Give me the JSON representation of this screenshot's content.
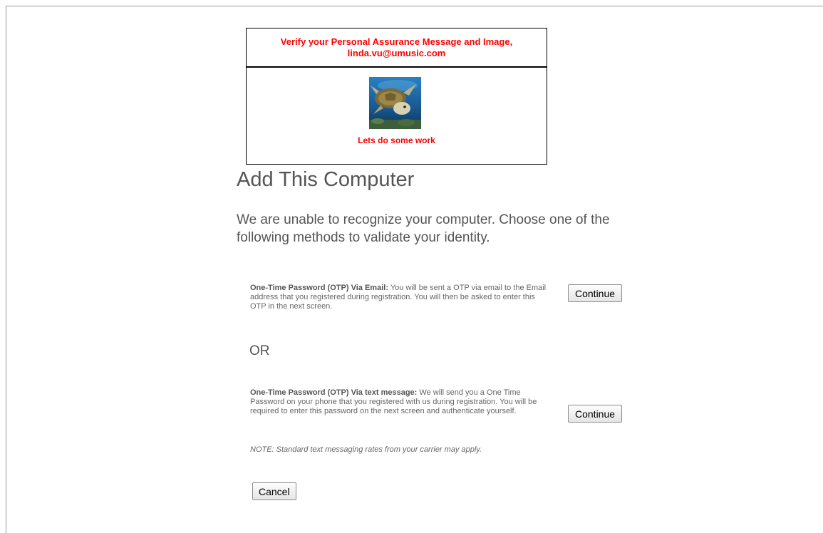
{
  "pam": {
    "heading": "Verify your Personal Assurance Message and Image, linda.vu@umusic.com",
    "image_icon": "sea-turtle-image",
    "message": "Lets do some work",
    "accent_color": "#ff0000"
  },
  "page": {
    "title": "Add This Computer",
    "intro": "We are unable to recognize your computer. Choose one of the following methods to validate your identity."
  },
  "options": {
    "email": {
      "label": "One-Time Password (OTP) Via Email:",
      "description": " You will be sent a OTP via email to the Email address that you registered during registration. You will then be asked to enter this OTP in the next screen.",
      "button": "Continue"
    },
    "separator": "OR",
    "text": {
      "label": "One-Time Password (OTP) Via text message:",
      "description": " We will send you a One Time Password on your phone that you registered with us during registration. You will be required to enter this password on the next screen and authenticate yourself.",
      "note": "NOTE: Standard text messaging rates from your carrier may apply.",
      "button": "Continue"
    }
  },
  "actions": {
    "cancel": "Cancel"
  }
}
